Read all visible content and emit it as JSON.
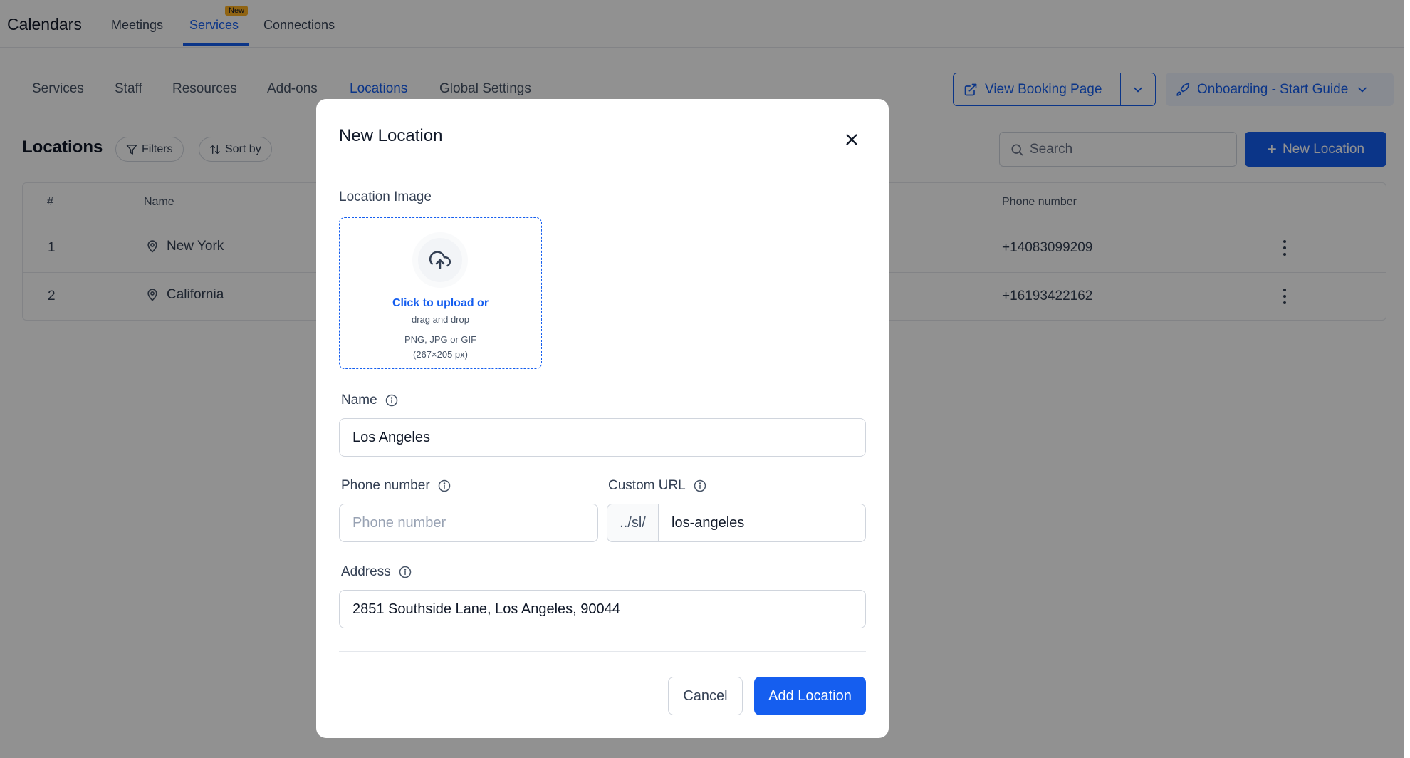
{
  "app": {
    "title": "Calendars",
    "top_tabs": [
      "Meetings",
      "Services",
      "Connections"
    ],
    "active_top_tab": "Services",
    "new_badge": "New"
  },
  "subnav": {
    "tabs": [
      "Services",
      "Staff",
      "Resources",
      "Add-ons",
      "Locations",
      "Global Settings"
    ],
    "active": "Locations"
  },
  "header_actions": {
    "view_booking": "View Booking Page",
    "onboarding": "Onboarding - Start Guide"
  },
  "toolbar": {
    "title": "Locations",
    "filters": "Filters",
    "sort_by": "Sort by",
    "search_placeholder": "Search",
    "new_location": "New Location"
  },
  "table": {
    "columns": {
      "index": "#",
      "name": "Name",
      "phone": "Phone number"
    },
    "rows": [
      {
        "index": "1",
        "name": "New York",
        "phone": "+14083099209"
      },
      {
        "index": "2",
        "name": "California",
        "phone": "+16193422162"
      }
    ]
  },
  "modal": {
    "title": "New Location",
    "image_label": "Location Image",
    "upload_cta": "Click to upload or",
    "upload_hint": "drag and drop",
    "upload_formats": "PNG, JPG or GIF",
    "upload_size": "(267×205 px)",
    "name_label": "Name",
    "name_value": "Los Angeles",
    "phone_label": "Phone number",
    "phone_placeholder": "Phone number",
    "url_label": "Custom URL",
    "url_prefix": "../sl/",
    "url_value": "los-angeles",
    "address_label": "Address",
    "address_value": "2851 Southside Lane, Los Angeles, 90044",
    "cancel": "Cancel",
    "submit": "Add Location"
  },
  "colors": {
    "primary": "#155eef",
    "badge": "#fdb022",
    "overlay": "rgba(0,0,0,0.43)"
  }
}
